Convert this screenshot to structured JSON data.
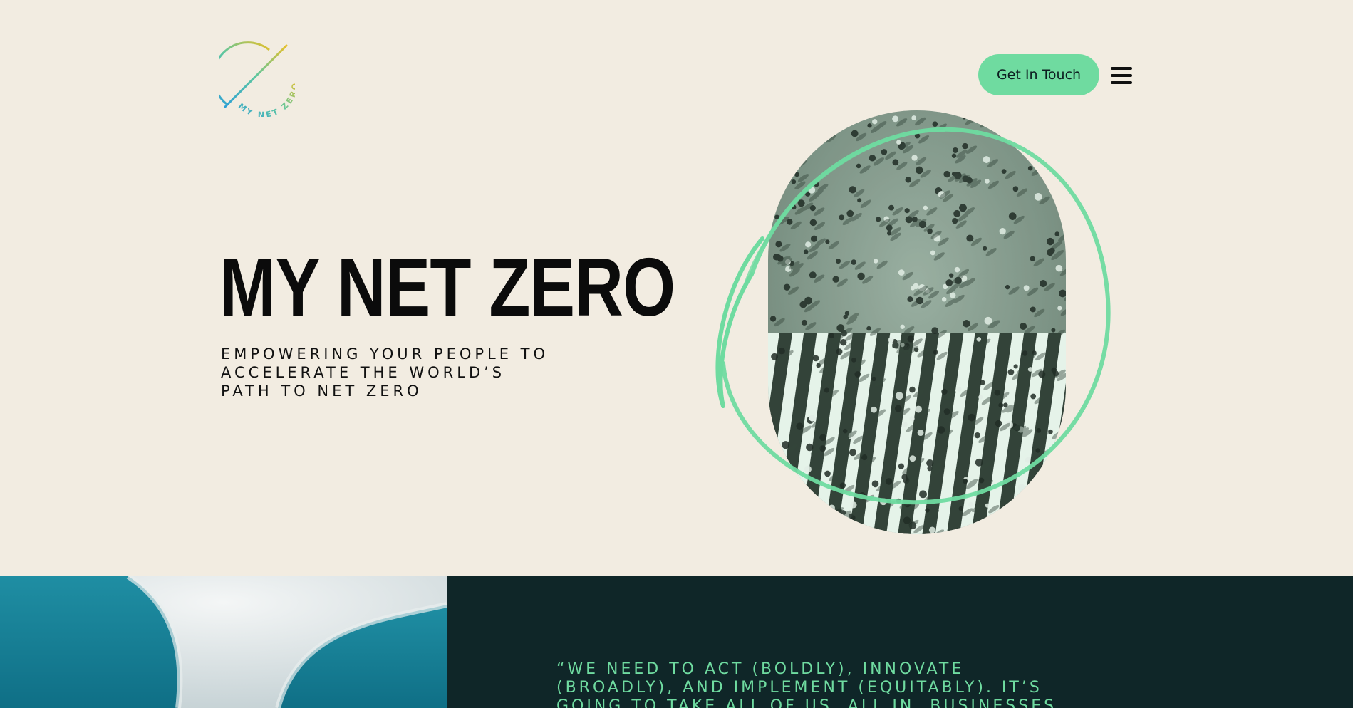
{
  "header": {
    "logo_text": "MY NET ZERO",
    "cta_label": "Get In Touch",
    "menu_icon": "hamburger-menu-icon"
  },
  "hero": {
    "title": "MY NET ZERO",
    "subtitle_lines": [
      "EMPOWERING YOUR PEOPLE TO",
      "ACCELERATE THE WORLD’S",
      "PATH TO NET ZERO"
    ],
    "image": "aerial-crowd-crosswalk-photo"
  },
  "quote_section": {
    "image": "aerial-ice-and-water-photo",
    "quote_lines": [
      "“WE NEED TO ACT (BOLDLY), INNOVATE",
      "(BROADLY), AND IMPLEMENT (EQUITABLY). IT’S",
      "GOING TO TAKE ALL OF US, ALL IN. BUSINESSES"
    ]
  },
  "colors": {
    "background": "#f2ece1",
    "accent": "#6fdba0",
    "dark_panel": "#0f2628",
    "text": "#0b0b0b"
  }
}
